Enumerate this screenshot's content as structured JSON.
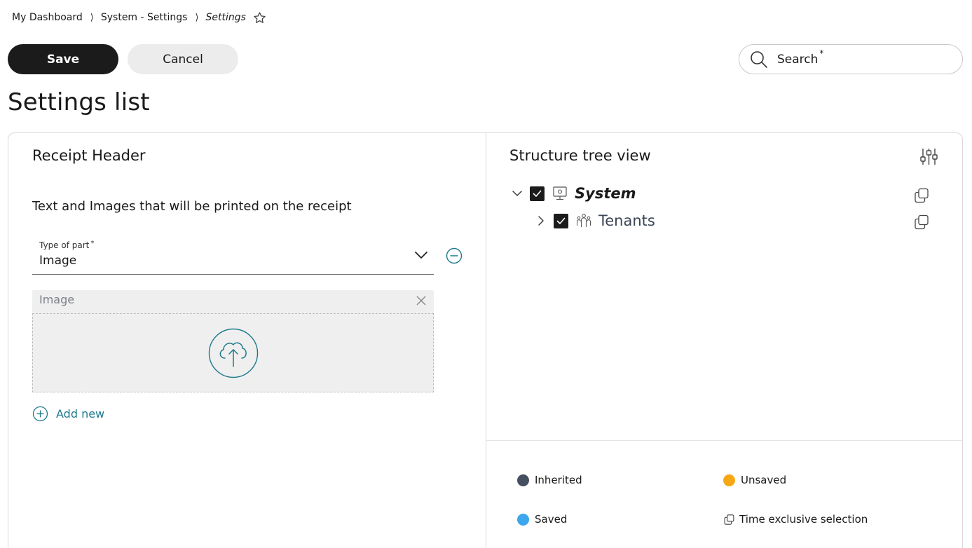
{
  "breadcrumb": {
    "items": [
      "My Dashboard",
      "System - Settings",
      "Settings"
    ],
    "separator": "⟩"
  },
  "toolbar": {
    "save_label": "Save",
    "cancel_label": "Cancel"
  },
  "search": {
    "label": "Search",
    "required_mark": "*"
  },
  "page": {
    "title": "Settings list"
  },
  "left_panel": {
    "title": "Receipt Header",
    "description": "Text and Images that will be printed on the receipt",
    "type_select": {
      "label": "Type of part",
      "required_mark": "*",
      "value": "Image"
    },
    "image_field": {
      "label": "Image"
    },
    "add_new_label": "Add new"
  },
  "right_panel": {
    "title": "Structure tree view",
    "tree": [
      {
        "label": "System",
        "expanded": true,
        "checked": true
      },
      {
        "label": "Tenants",
        "expanded": false,
        "checked": true
      }
    ],
    "legend": {
      "inherited": {
        "label": "Inherited",
        "color": "#454f60"
      },
      "unsaved": {
        "label": "Unsaved",
        "color": "#f5a716"
      },
      "saved": {
        "label": "Saved",
        "color": "#3da6ec"
      },
      "time_exclusive": {
        "label": "Time exclusive selection",
        "icon": "copy-icon"
      }
    }
  },
  "colors": {
    "accent": "#1e7a8c",
    "primary_button": "#1b1b1b",
    "secondary_button": "#ececec"
  }
}
